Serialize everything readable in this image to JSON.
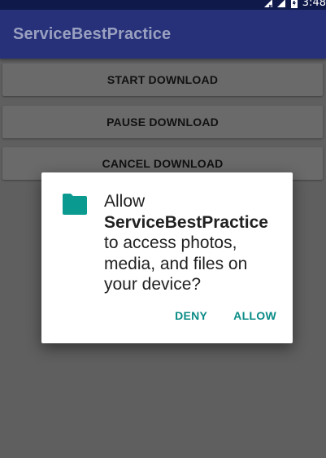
{
  "status_bar": {
    "time": "3:48",
    "icons": [
      "no-data-icon",
      "cell-signal-icon",
      "battery-icon"
    ]
  },
  "app_bar": {
    "title": "ServiceBestPractice"
  },
  "buttons": {
    "start_label": "START DOWNLOAD",
    "pause_label": "PAUSE DOWNLOAD",
    "cancel_label": "CANCEL DOWNLOAD"
  },
  "dialog": {
    "icon": "folder-icon",
    "message_prefix": "Allow",
    "app_name": "ServiceBestPractice",
    "message_suffix": "to access photos, media, and files on your device?",
    "deny_label": "DENY",
    "allow_label": "ALLOW"
  },
  "colors": {
    "status_bar": "#0f1a4a",
    "app_bar": "#263179",
    "scrim_background": "#5f5f5f",
    "accent": "#0a8c86",
    "folder_icon": "#0a9a8f"
  }
}
